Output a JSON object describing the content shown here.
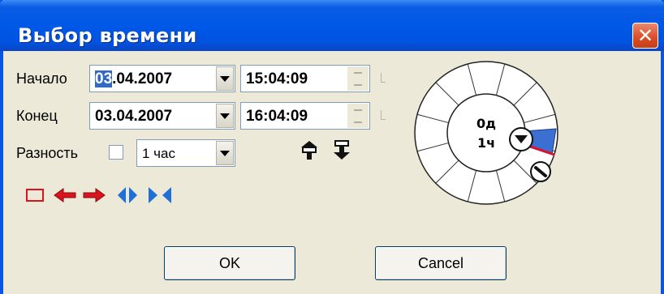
{
  "window": {
    "title": "Выбор времени",
    "close_glyph": "✕"
  },
  "start": {
    "label": "Начало",
    "date_selected": "03",
    "date_rest": ".04.2007",
    "time": "15:04:09"
  },
  "end": {
    "label": "Конец",
    "date": "03.04.2007",
    "time": "16:04:09"
  },
  "difference": {
    "label": "Разность",
    "checked": false,
    "value": "1 час"
  },
  "clock": {
    "days": "0д",
    "hours": "1ч",
    "accent_color": "#3b6fd1",
    "marker_color": "#e0102a"
  },
  "icons": [
    "rectangle-select-icon",
    "arrow-left-icon",
    "arrow-right-icon",
    "expand-icon",
    "collapse-icon",
    "pin-up-icon",
    "pin-down-icon"
  ],
  "buttons": {
    "ok": "OK",
    "cancel": "Cancel"
  },
  "colors": {
    "titlebar": "#0058e6",
    "dialog_bg": "#ece9d8",
    "icon_red": "#d9141e",
    "icon_blue": "#1f6fd6"
  }
}
